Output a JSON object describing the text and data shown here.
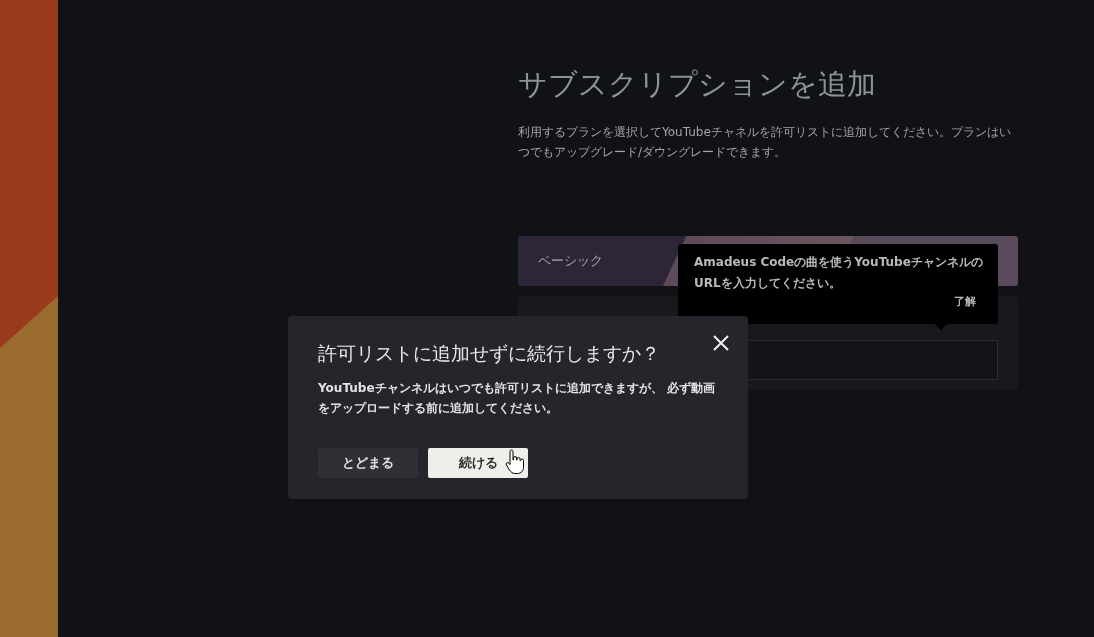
{
  "page": {
    "title": "サブスクリプションを追加",
    "description": "利用するプランを選択してYouTubeチャネルを許可リストに追加してください。プランはいつでもアップグレード/ダウングレードできます。"
  },
  "plan": {
    "name": "ベーシック"
  },
  "tooltip": {
    "text": "Amadeus Codeの曲を使うYouTubeチャンネルのURLを入力してください。",
    "action": "了解"
  },
  "dialog": {
    "title": "許可リストに追加せずに続行しますか？",
    "message": "YouTubeチャンネルはいつでも許可リストに追加できますが、 必ず動画をアップロードする前に追加してください。",
    "buttons": [
      {
        "label": "とどまる",
        "kind": "secondary"
      },
      {
        "label": "続ける",
        "kind": "primary"
      }
    ]
  }
}
